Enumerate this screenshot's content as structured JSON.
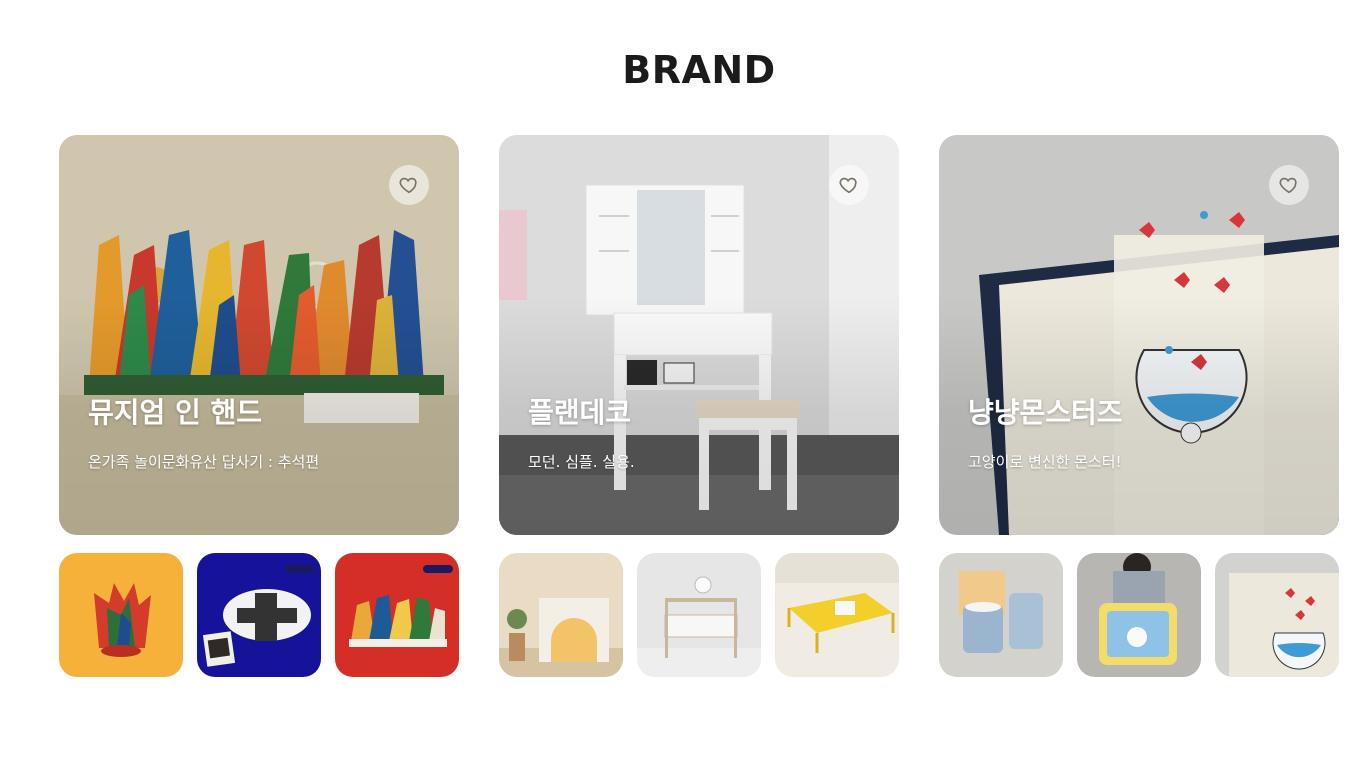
{
  "section": {
    "title": "BRAND"
  },
  "brands": [
    {
      "name": "뮤지엄 인 핸드",
      "tagline": "온가족 놀이문화유산 답사기 : 추석편",
      "wishlist_icon": "heart-outline-icon",
      "thumbnails": [
        {
          "label": "",
          "badge": ""
        },
        {
          "label": "",
          "badge": ""
        },
        {
          "label": "",
          "badge": ""
        }
      ]
    },
    {
      "name": "플랜데코",
      "tagline": "모던. 심플. 실용.",
      "wishlist_icon": "heart-outline-icon"
    },
    {
      "name": "냥냥몬스터즈",
      "tagline": "고양이로 변신한 몬스터!",
      "wishlist_icon": "heart-outline-icon"
    }
  ],
  "colors": {
    "background": "#ffffff",
    "title": "#1b1b1b",
    "overlay_text": "#ffffff"
  }
}
